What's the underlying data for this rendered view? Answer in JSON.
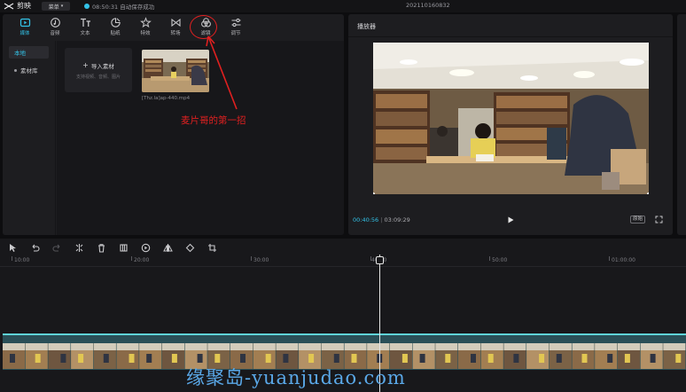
{
  "app": {
    "name": "剪映",
    "menu_label": "菜单",
    "save_status": "08:50:31 自动保存成功",
    "project_title": "202110160832"
  },
  "colors": {
    "accent": "#33c3e8",
    "annotation": "#e02020",
    "watermark": "#5aa8e8"
  },
  "media_tabs": [
    {
      "label": "媒体",
      "icon": "media-icon"
    },
    {
      "label": "音频",
      "icon": "audio-icon"
    },
    {
      "label": "文本",
      "icon": "text-icon"
    },
    {
      "label": "贴纸",
      "icon": "sticker-icon"
    },
    {
      "label": "特效",
      "icon": "effects-icon"
    },
    {
      "label": "转场",
      "icon": "transition-icon"
    },
    {
      "label": "滤镜",
      "icon": "filter-icon"
    },
    {
      "label": "调节",
      "icon": "adjust-icon"
    }
  ],
  "media_sidebar": [
    "本地",
    "素材库"
  ],
  "import": {
    "title": "导入素材",
    "subtitle": "支持视频、音频、图片"
  },
  "clip": {
    "filename": "[Thz.la]ap-440.mp4"
  },
  "annotation": {
    "text": "麦片哥的第一招"
  },
  "player": {
    "title": "播放器",
    "current_time": "00:40:56",
    "total_time": "03:09:29",
    "ratio_label": "原始"
  },
  "timeline": {
    "ticks": [
      "10:00",
      "20:00",
      "30:00",
      "40:00",
      "50:00",
      "01:00:00"
    ]
  },
  "watermark": "缘聚岛-yuanjudao.com"
}
